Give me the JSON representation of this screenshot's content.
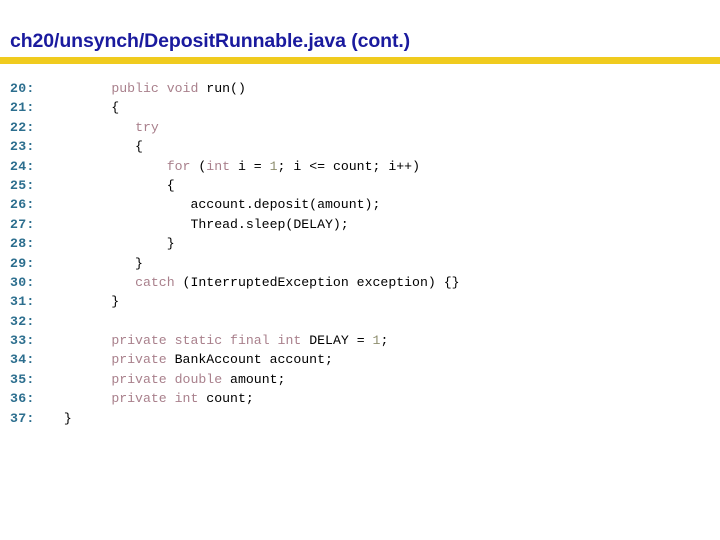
{
  "header": {
    "title": "ch20/unsynch/DepositRunnable.java  (cont.)",
    "title_color": "#1a1a9e",
    "rule_color": "#f0cb1e"
  },
  "theme": {
    "background": "#ffffff",
    "lineno_color": "#2c6e8e",
    "keyword_color": "#a9808c",
    "number_color": "#8e8e6e",
    "identifier_color": "#000000"
  },
  "code": {
    "first_line_number": 20,
    "last_line_number": 37,
    "lines": [
      {
        "no": "20:",
        "tokens": [
          {
            "t": "        ",
            "c": "punct"
          },
          {
            "t": "public",
            "c": "kw"
          },
          {
            "t": " ",
            "c": "punct"
          },
          {
            "t": "void",
            "c": "kw"
          },
          {
            "t": " run()",
            "c": "id"
          }
        ]
      },
      {
        "no": "21:",
        "tokens": [
          {
            "t": "        {",
            "c": "id"
          }
        ]
      },
      {
        "no": "22:",
        "tokens": [
          {
            "t": "           ",
            "c": "punct"
          },
          {
            "t": "try",
            "c": "kw"
          }
        ]
      },
      {
        "no": "23:",
        "tokens": [
          {
            "t": "           {",
            "c": "id"
          }
        ]
      },
      {
        "no": "24:",
        "tokens": [
          {
            "t": "               ",
            "c": "punct"
          },
          {
            "t": "for",
            "c": "kw"
          },
          {
            "t": " (",
            "c": "id"
          },
          {
            "t": "int",
            "c": "kw"
          },
          {
            "t": " i = ",
            "c": "id"
          },
          {
            "t": "1",
            "c": "num"
          },
          {
            "t": "; i <= count; i++)",
            "c": "id"
          }
        ]
      },
      {
        "no": "25:",
        "tokens": [
          {
            "t": "               {",
            "c": "id"
          }
        ]
      },
      {
        "no": "26:",
        "tokens": [
          {
            "t": "                  account.deposit(amount);",
            "c": "id"
          }
        ]
      },
      {
        "no": "27:",
        "tokens": [
          {
            "t": "                  Thread.sleep(DELAY);",
            "c": "id"
          }
        ]
      },
      {
        "no": "28:",
        "tokens": [
          {
            "t": "               }",
            "c": "id"
          }
        ]
      },
      {
        "no": "29:",
        "tokens": [
          {
            "t": "           }",
            "c": "id"
          }
        ]
      },
      {
        "no": "30:",
        "tokens": [
          {
            "t": "           ",
            "c": "punct"
          },
          {
            "t": "catch",
            "c": "kw"
          },
          {
            "t": " (InterruptedException exception) {}",
            "c": "id"
          }
        ]
      },
      {
        "no": "31:",
        "tokens": [
          {
            "t": "        }",
            "c": "id"
          }
        ]
      },
      {
        "no": "32:",
        "tokens": [
          {
            "t": "",
            "c": "id"
          }
        ]
      },
      {
        "no": "33:",
        "tokens": [
          {
            "t": "        ",
            "c": "punct"
          },
          {
            "t": "private",
            "c": "kw"
          },
          {
            "t": " ",
            "c": "punct"
          },
          {
            "t": "static",
            "c": "kw"
          },
          {
            "t": " ",
            "c": "punct"
          },
          {
            "t": "final",
            "c": "kw"
          },
          {
            "t": " ",
            "c": "punct"
          },
          {
            "t": "int",
            "c": "kw"
          },
          {
            "t": " DELAY = ",
            "c": "id"
          },
          {
            "t": "1",
            "c": "num"
          },
          {
            "t": ";",
            "c": "id"
          }
        ]
      },
      {
        "no": "34:",
        "tokens": [
          {
            "t": "        ",
            "c": "punct"
          },
          {
            "t": "private",
            "c": "kw"
          },
          {
            "t": " BankAccount account;",
            "c": "id"
          }
        ]
      },
      {
        "no": "35:",
        "tokens": [
          {
            "t": "        ",
            "c": "punct"
          },
          {
            "t": "private",
            "c": "kw"
          },
          {
            "t": " ",
            "c": "punct"
          },
          {
            "t": "double",
            "c": "kw"
          },
          {
            "t": " amount;",
            "c": "id"
          }
        ]
      },
      {
        "no": "36:",
        "tokens": [
          {
            "t": "        ",
            "c": "punct"
          },
          {
            "t": "private",
            "c": "kw"
          },
          {
            "t": " ",
            "c": "punct"
          },
          {
            "t": "int",
            "c": "kw"
          },
          {
            "t": " count;",
            "c": "id"
          }
        ]
      },
      {
        "no": "37:",
        "tokens": [
          {
            "t": "  }",
            "c": "id"
          }
        ]
      }
    ]
  }
}
